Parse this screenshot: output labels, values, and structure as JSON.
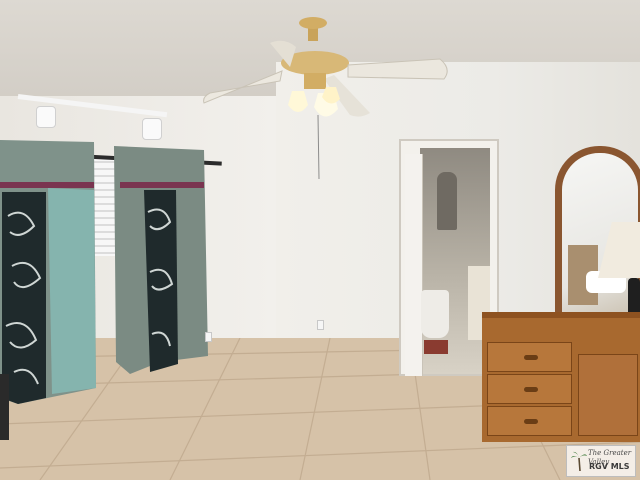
{
  "scene": {
    "description_label": "bedroom interior",
    "colors": {
      "wall": "#efede8",
      "floor_tile": "#d6c2a8",
      "curtain": "#7c8f86",
      "dresser_wood": "#a8692f",
      "mirror_frame": "#8a5630"
    }
  },
  "watermark": {
    "brand_line": "The Greater Valley",
    "org_line": "RGV MLS",
    "icon": "palm-tree-icon"
  }
}
